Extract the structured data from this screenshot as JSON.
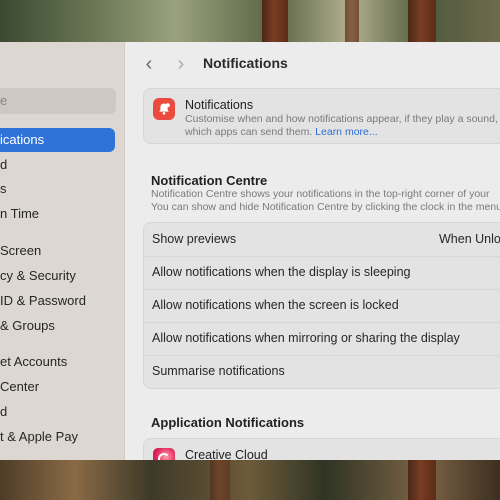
{
  "sidebar": {
    "search_placeholder": "e",
    "items": [
      {
        "label": "ications",
        "active": true
      },
      {
        "label": "d"
      },
      {
        "label": "s"
      },
      {
        "label": "n Time"
      },
      {
        "label": "Screen"
      },
      {
        "label": "cy & Security"
      },
      {
        "label": "ID & Password"
      },
      {
        "label": "& Groups"
      },
      {
        "label": "et Accounts"
      },
      {
        "label": "Center"
      },
      {
        "label": "d"
      },
      {
        "label": "t & Apple Pay"
      }
    ]
  },
  "header": {
    "back_icon": "‹",
    "forward_icon": "›",
    "title": "Notifications"
  },
  "intro": {
    "icon": "bell-badge-icon",
    "title": "Notifications",
    "desc_line1": "Customise when and how notifications appear, if they play a sound,",
    "desc_line2": "which apps can send them.",
    "link": "Learn more..."
  },
  "centre": {
    "title": "Notification Centre",
    "desc_line1": "Notification Centre shows your notifications in the top-right corner of your",
    "desc_line2": "You can show and hide Notification Centre by clicking the clock in the menu",
    "rows": [
      {
        "label": "Show previews",
        "value": "When Unloc"
      },
      {
        "label": "Allow notifications when the display is sleeping"
      },
      {
        "label": "Allow notifications when the screen is locked"
      },
      {
        "label": "Allow notifications when mirroring or sharing the display"
      },
      {
        "label": "Summarise notifications"
      }
    ]
  },
  "apps": {
    "title": "Application Notifications",
    "items": [
      {
        "label": "Creative Cloud",
        "icon": "creative-cloud-icon"
      }
    ]
  },
  "colors": {
    "accent": "#2f73d9",
    "notifications_icon": "#ea4b3e",
    "link": "#2f6ed6"
  }
}
